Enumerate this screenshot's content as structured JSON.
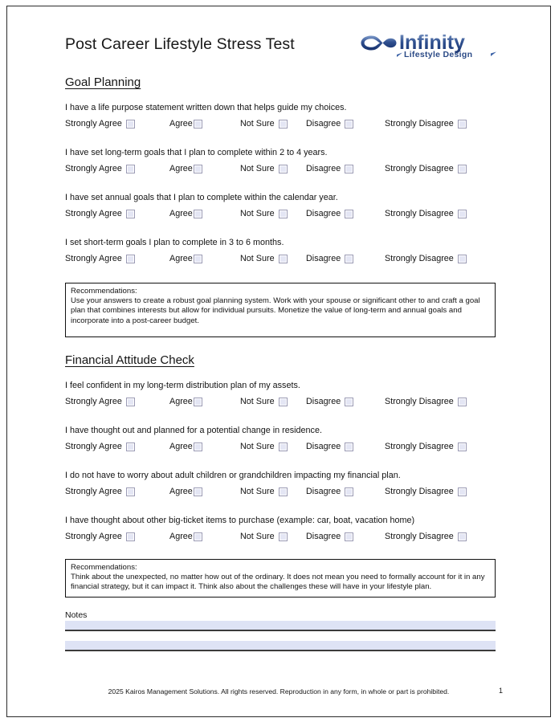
{
  "document": {
    "title": "Post Career Lifestyle Stress Test"
  },
  "logo": {
    "brand": "Infinity",
    "tagline": "Lifestyle Design",
    "symbol": "infinity-symbol",
    "brand_color": "#2d4f8e",
    "tagline_color": "#2b4a86"
  },
  "scale": {
    "options": [
      "Strongly Agree",
      "Agree",
      "Not Sure",
      "Disagree",
      "Strongly Disagree"
    ]
  },
  "sections": [
    {
      "heading": "Goal Planning",
      "questions": [
        "I have a life purpose statement written down that helps guide my choices.",
        "I have set long-term goals that I plan to complete within 2 to 4 years.",
        "I have set annual goals that I plan to complete within the calendar year.",
        "I set short-term goals I plan to complete in 3 to 6 months."
      ],
      "recommendations_label": "Recommendations:",
      "recommendations_body": "Use your answers to create a robust goal planning system. Work with your spouse or significant other to and craft a goal plan that combines interests but allow for individual pursuits. Monetize the value of long-term and annual goals and incorporate into a post-career budget."
    },
    {
      "heading": "Financial Attitude Check",
      "questions": [
        "I feel confident in my long-term distribution plan of my assets.",
        "I have thought out and planned for a potential change in residence.",
        "I do not have to worry about adult children or grandchildren impacting my financial plan.",
        "I have thought about other big-ticket items to purchase (example: car, boat, vacation home)"
      ],
      "recommendations_label": "Recommendations:",
      "recommendations_body": "Think about the unexpected, no matter how out of the ordinary. It does not mean you need to formally account for it in any financial strategy, but it can impact it. Think also about the challenges these will have in your lifestyle plan."
    }
  ],
  "notes": {
    "label": "Notes",
    "line_count": 2,
    "fill_color": "#dee3f5"
  },
  "footer": {
    "copyright": "2025 Kairos Management Solutions. All rights reserved. Reproduction in any form, in whole or part is prohibited.",
    "page_number": "1"
  }
}
